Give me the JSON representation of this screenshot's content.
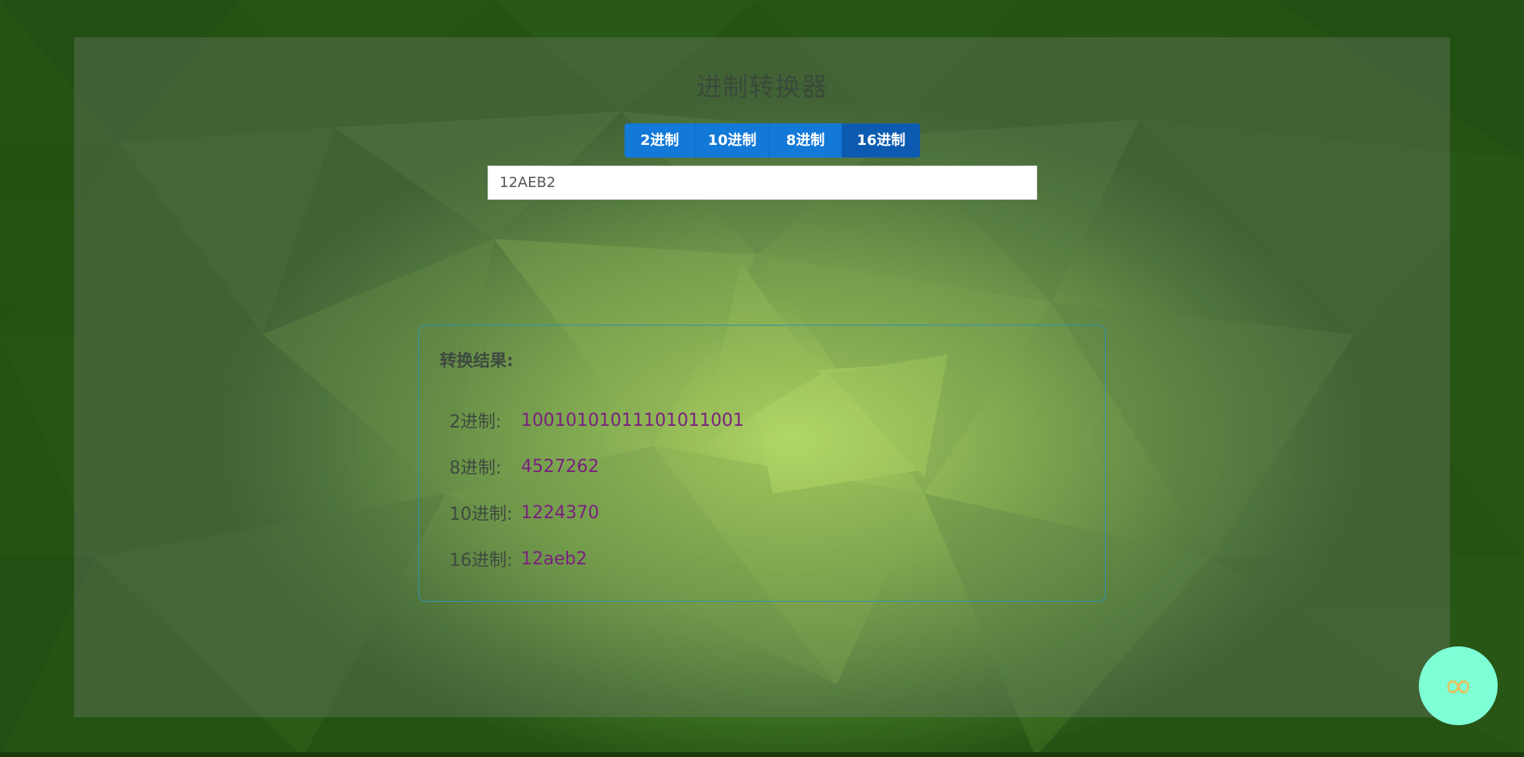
{
  "app": {
    "title": "进制转换器"
  },
  "tabs": [
    {
      "label": "2进制",
      "active": false
    },
    {
      "label": "10进制",
      "active": false
    },
    {
      "label": "8进制",
      "active": false
    },
    {
      "label": "16进制",
      "active": true
    }
  ],
  "input": {
    "value": "12AEB2"
  },
  "result": {
    "title": "转换结果:",
    "rows": [
      {
        "label": "2进制:",
        "value": "10010101011101011001"
      },
      {
        "label": "8进制:",
        "value": "4527262"
      },
      {
        "label": "10进制:",
        "value": "1224370"
      },
      {
        "label": "16进制:",
        "value": "12aeb2"
      }
    ]
  },
  "fab": {
    "icon": "infinity-icon",
    "glyph": "∞"
  },
  "colors": {
    "tab": "#1379d8",
    "tab_active": "#0d5bb0",
    "result_value": "#7a1f7f",
    "result_border": "#3a8fb0",
    "fab_bg": "#7effd6",
    "fab_icon": "#e8c15a"
  }
}
